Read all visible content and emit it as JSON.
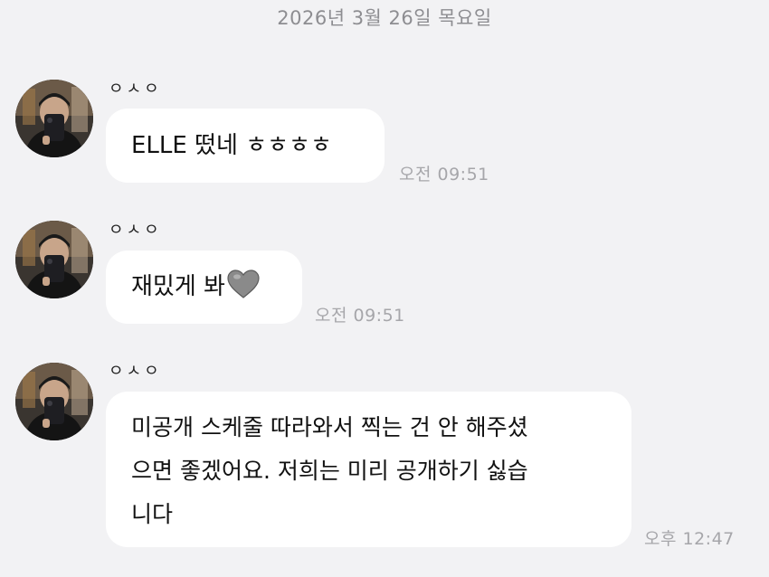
{
  "date_header": "2026년 3월 26일 목요일",
  "colors": {
    "background": "#f2f2f4",
    "bubble": "#ffffff",
    "timestamp": "#a6a6aa",
    "heart": "#8a8a8a"
  },
  "messages": [
    {
      "sender": "ㅇㅅㅇ",
      "text": "ELLE 떴네 ㅎㅎㅎㅎ",
      "time": "오전 09:51"
    },
    {
      "sender": "ㅇㅅㅇ",
      "text": "재밌게 봐",
      "emoji": "grey-heart-icon",
      "time": "오전 09:51"
    },
    {
      "sender": "ㅇㅅㅇ",
      "lines": [
        "미공개 스케줄 따라와서 찍는 건 안 해주셨",
        "으면 좋겠어요. 저희는 미리 공개하기 싫습",
        "니다"
      ],
      "time": "오후 12:47"
    }
  ]
}
